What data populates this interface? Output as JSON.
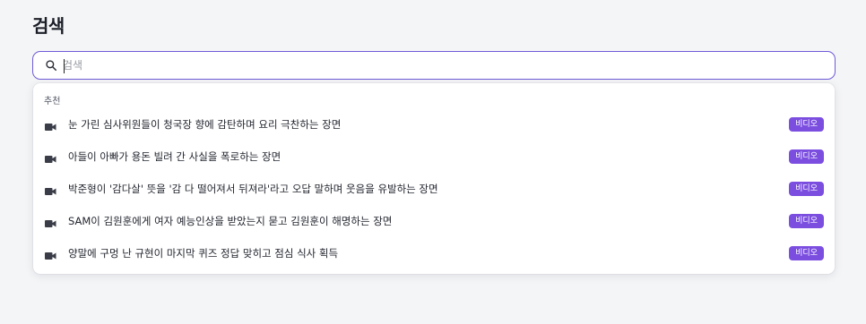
{
  "page": {
    "title": "검색"
  },
  "search": {
    "placeholder": "검색",
    "value": ""
  },
  "dropdown": {
    "section_label": "추천",
    "items": [
      {
        "icon": "video-icon",
        "text": "눈 가린 심사위원들이 청국장 향에 감탄하며 요리 극찬하는 장면",
        "badge": "비디오"
      },
      {
        "icon": "video-icon",
        "text": "아들이 아빠가 용돈 빌려 간 사실을 폭로하는 장면",
        "badge": "비디오"
      },
      {
        "icon": "video-icon",
        "text": "박준형이 '감다살' 뜻을 '감 다 떨어져서 뒤져라'라고 오답 말하며 웃음을 유발하는 장면",
        "badge": "비디오"
      },
      {
        "icon": "video-icon",
        "text": "SAM이 김원훈에게 여자 예능인상을 받았는지 묻고 김원훈이 해명하는 장면",
        "badge": "비디오"
      },
      {
        "icon": "video-icon",
        "text": "양말에 구멍 난 규현이 마지막 퀴즈 정답 맞히고 점심 식사 획득",
        "badge": "비디오"
      }
    ]
  },
  "colors": {
    "accent": "#6e5ad8",
    "badge": "#7b4ee0",
    "background": "#f4f5f7"
  }
}
